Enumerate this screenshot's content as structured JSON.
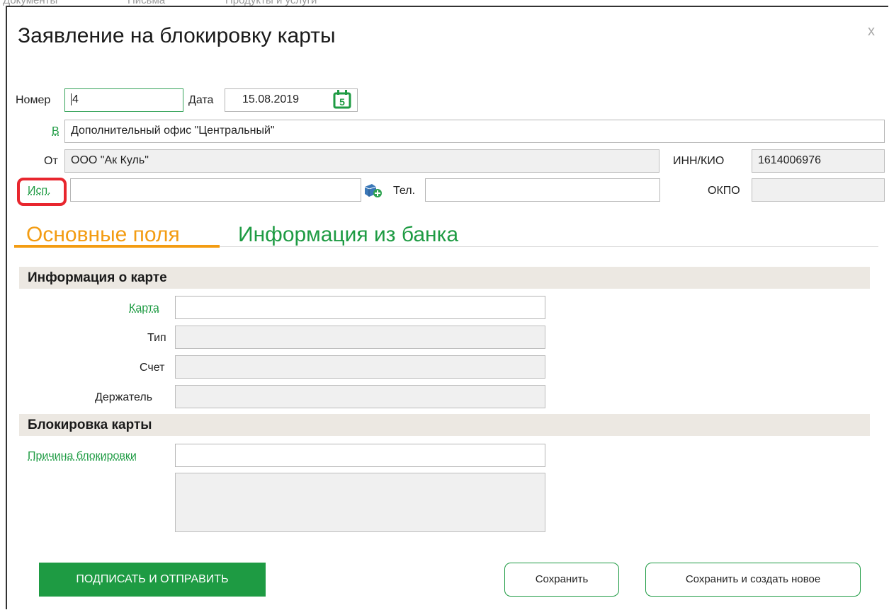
{
  "background_nav": [
    "Документы",
    "Письма",
    "Продукты и услуги"
  ],
  "dialog": {
    "title": "Заявление на блокировку карты",
    "close_glyph": "x"
  },
  "header_form": {
    "number_label": "Номер",
    "number_value": "4",
    "date_label": "Дата",
    "date_value": "15.08.2019",
    "calendar_icon_digit": "5",
    "to_label": "В",
    "to_value": "Дополнительный офис \"Центральный\"",
    "from_label": "От",
    "from_value": "ООО \"Ак Куль\"",
    "inn_label": "ИНН/КИО",
    "inn_value": "1614006976",
    "executor_label": "Исп.",
    "executor_value": "",
    "phone_label": "Тел.",
    "phone_value": "",
    "okpo_label": "ОКПО",
    "okpo_value": ""
  },
  "tabs": [
    {
      "label": "Основные поля",
      "active": true
    },
    {
      "label": "Информация из банка",
      "active": false
    }
  ],
  "card_info": {
    "title": "Информация о карте",
    "card_label": "Карта",
    "card_value": "",
    "type_label": "Тип",
    "type_value": "",
    "account_label": "Счет",
    "account_value": "",
    "holder_label": "Держатель",
    "holder_value": ""
  },
  "card_block": {
    "title": "Блокировка карты",
    "reason_label": "Причина блокировки",
    "reason_value": "",
    "reason_details": ""
  },
  "buttons": {
    "sign_send": "ПОДПИСАТЬ И ОТПРАВИТЬ",
    "save": "Сохранить",
    "save_new": "Сохранить и создать новое"
  },
  "colors": {
    "accent_green": "#1e9b43",
    "active_tab_orange": "#f39c12",
    "highlight_red": "#e8262e",
    "section_bg": "#ece8e2",
    "readonly_bg": "#f0f0f0"
  },
  "icons": [
    "calendar-icon",
    "contact-add-icon",
    "close-icon"
  ]
}
